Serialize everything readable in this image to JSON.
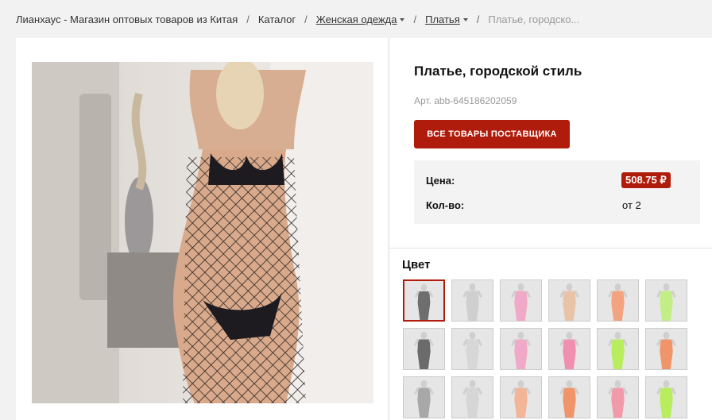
{
  "breadcrumb": {
    "items": [
      {
        "label": "Лианхаус - Магазин оптовых товаров из Китая",
        "dropdown": false
      },
      {
        "label": "Каталог",
        "dropdown": false
      },
      {
        "label": "Женская одежда",
        "dropdown": true
      },
      {
        "label": "Платья",
        "dropdown": true
      }
    ],
    "separator": "/",
    "current": "Платье, городско..."
  },
  "product": {
    "title": "Платье, городской стиль",
    "sku": "Арт. abb-645186202059",
    "supplier_button": "ВСЕ ТОВАРЫ ПОСТАВЩИКА",
    "price_label": "Цена:",
    "price": "508.75 ₽",
    "qty_label": "Кол-во:",
    "qty": "от 2"
  },
  "colors": {
    "title": "Цвет",
    "selected_index": 0,
    "swatches": [
      {
        "color": "#6e6e6e"
      },
      {
        "color": "#cfcfcf"
      },
      {
        "color": "#f0a9c6"
      },
      {
        "color": "#e9c3a8"
      },
      {
        "color": "#f3a37f"
      },
      {
        "color": "#c3ee86"
      },
      {
        "color": "#6b6b6b"
      },
      {
        "color": "#d7d7d7"
      },
      {
        "color": "#f0a9c6"
      },
      {
        "color": "#f08fb0"
      },
      {
        "color": "#b8ee5e"
      },
      {
        "color": "#f0956a"
      },
      {
        "color": "#a8a8a8"
      },
      {
        "color": "#d6d6d6"
      },
      {
        "color": "#f3b597"
      },
      {
        "color": "#f0956a"
      },
      {
        "color": "#f19aa9"
      },
      {
        "color": "#b8ee5e"
      }
    ]
  },
  "accent_color": "#b01c0c"
}
